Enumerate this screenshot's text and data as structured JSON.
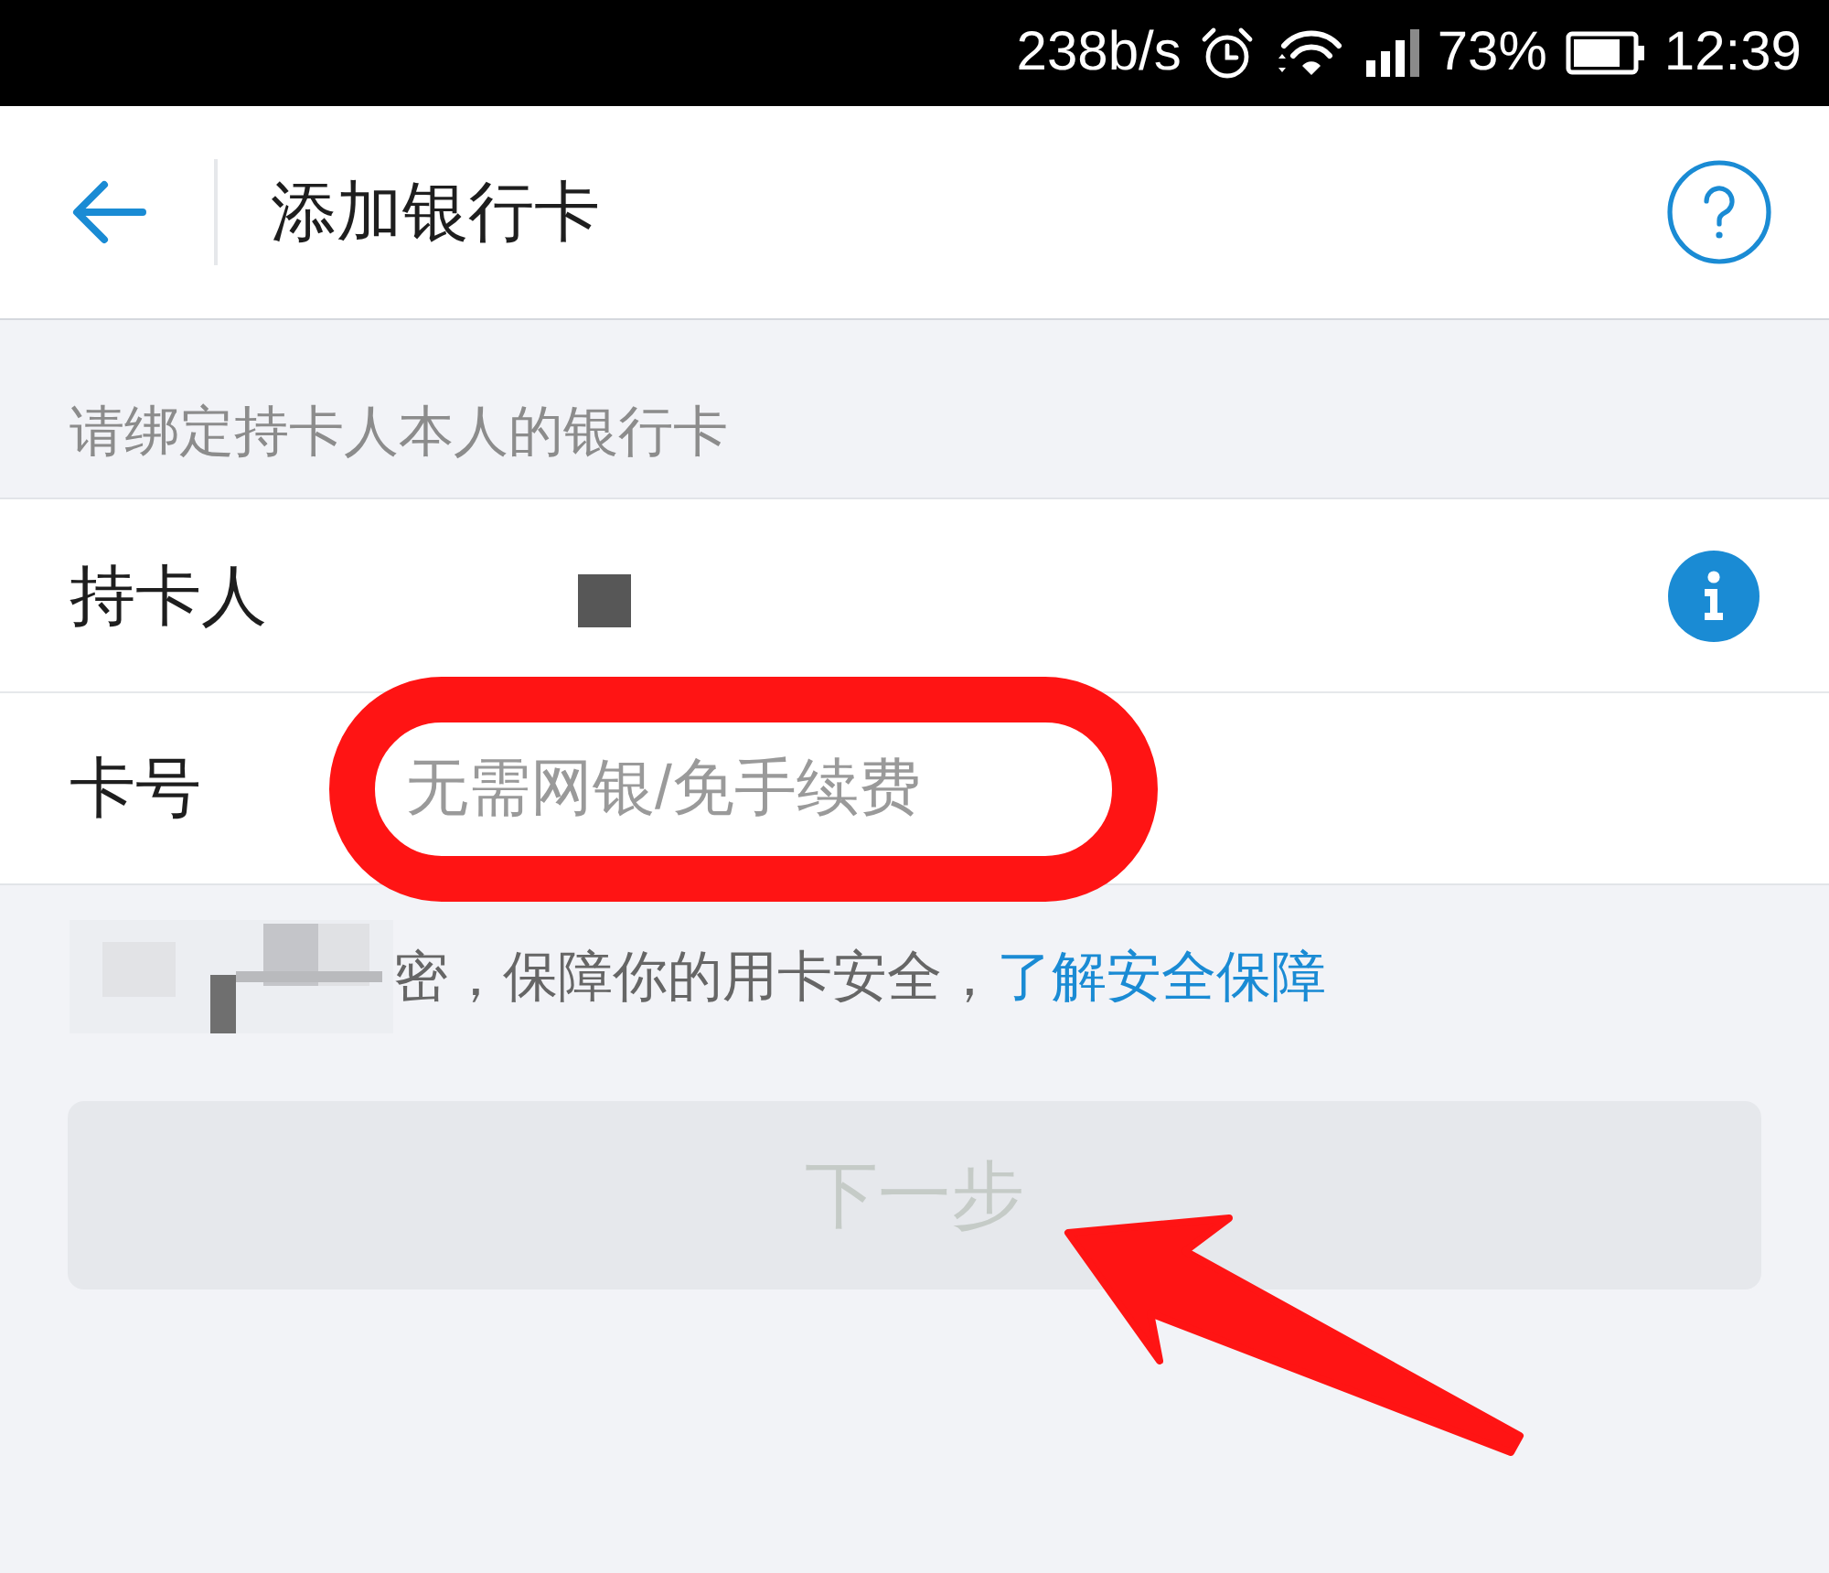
{
  "status_bar": {
    "network_speed": "238b/s",
    "battery": "73%",
    "time": "12:39"
  },
  "header": {
    "title": "添加银行卡"
  },
  "hint": "请绑定持卡人本人的银行卡",
  "fields": [
    {
      "kind": "readonly",
      "label": "持卡人",
      "redacted": true,
      "highlighted": false
    },
    {
      "kind": "input",
      "label": "卡号",
      "placeholder": "无需网银/免手续费",
      "highlighted": true
    }
  ],
  "security_note": {
    "redacted": true,
    "text": "密，保障你的用卡安全，",
    "link": "了解安全保障"
  },
  "next_button": {
    "label": "下一步",
    "disabled": true,
    "pointed_at": true
  }
}
